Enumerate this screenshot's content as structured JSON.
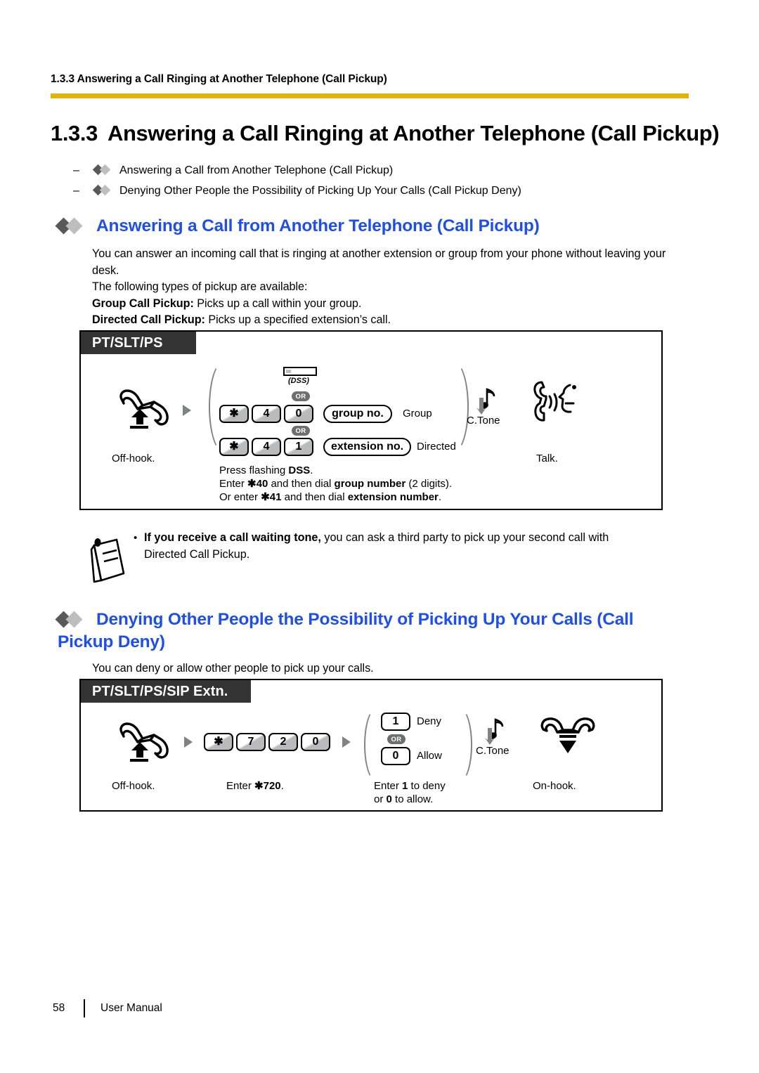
{
  "running_header": "1.3.3 Answering a Call Ringing at Another Telephone (Call Pickup)",
  "chapter": {
    "number": "1.3.3",
    "title": "Answering a Call Ringing at Another Telephone (Call Pickup)"
  },
  "toc": {
    "dash": "–",
    "items": [
      "Answering a Call from Another Telephone (Call Pickup)",
      "Denying Other People the Possibility of Picking Up Your Calls (Call Pickup Deny)"
    ]
  },
  "section1": {
    "heading": "Answering a Call from Another Telephone (Call Pickup)",
    "paragraph_line1": "You can answer an incoming call that is ringing at another extension or group from your phone without leaving",
    "paragraph_line2": "your desk.",
    "paragraph_line3": "The following types of pickup are available:",
    "group_label": "Group Call Pickup:",
    "group_desc": " Picks up a call within your group.",
    "directed_label": "Directed Call Pickup:",
    "directed_desc": " Picks up a specified extension’s call.",
    "box": {
      "tab": "PT/SLT/PS",
      "offhook_caption": "Off-hook.",
      "dss_button_label": "(DSS)",
      "or_badge": "OR",
      "row1_keys": [
        "✱",
        "4",
        "0"
      ],
      "row1_field": "group no.",
      "row1_label": "Group",
      "row2_keys": [
        "✱",
        "4",
        "1"
      ],
      "row2_field": "extension no.",
      "row2_label": "Directed",
      "ctone_caption": "C.Tone",
      "talk_caption": "Talk.",
      "instructions": [
        {
          "pre": "Press flashing ",
          "bold": "DSS",
          "post": "."
        },
        {
          "pre": "Enter ",
          "bold": "✱40",
          "post": " and then dial ",
          "bold2": "group number",
          "post2": " (2 digits)."
        },
        {
          "pre": "Or enter ",
          "bold": "✱41",
          "post": " and then dial ",
          "bold2": "extension number",
          "post2": "."
        }
      ]
    }
  },
  "note": {
    "bullet": "•",
    "bold_lead": "If you receive a call waiting tone,",
    "rest_line1": " you can ask a third party to pick up your second call with",
    "rest_line2": "Directed Call Pickup."
  },
  "section2": {
    "heading_line1": "Denying Other People the Possibility of Picking Up Your Calls (Call",
    "heading_line2": "Pickup Deny)",
    "paragraph": "You can deny or allow other people to pick up your calls.",
    "box": {
      "tab": "PT/SLT/PS/SIP Extn.",
      "offhook_caption": "Off-hook.",
      "keys": [
        "✱",
        "7",
        "2",
        "0"
      ],
      "enter_caption_pre": "Enter ",
      "enter_caption_bold": "✱720",
      "enter_caption_post": ".",
      "deny_key": "1",
      "deny_label": "Deny",
      "or_badge": "OR",
      "allow_key": "0",
      "allow_label": "Allow",
      "choice_caption_line1_pre": "Enter ",
      "choice_caption_line1_bold": "1",
      "choice_caption_line1_post": " to deny",
      "choice_caption_line2_pre": "or ",
      "choice_caption_line2_bold": "0",
      "choice_caption_line2_post": " to allow.",
      "ctone_caption": "C.Tone",
      "onhook_caption": "On-hook."
    }
  },
  "footer": {
    "page_number": "58",
    "label": "User Manual"
  },
  "colors": {
    "rule": "#e0b40a",
    "heading_blue": "#1f4ee8",
    "tab_dark": "#333333",
    "diamond_dark": "#58595b",
    "diamond_light": "#bcbec0"
  }
}
